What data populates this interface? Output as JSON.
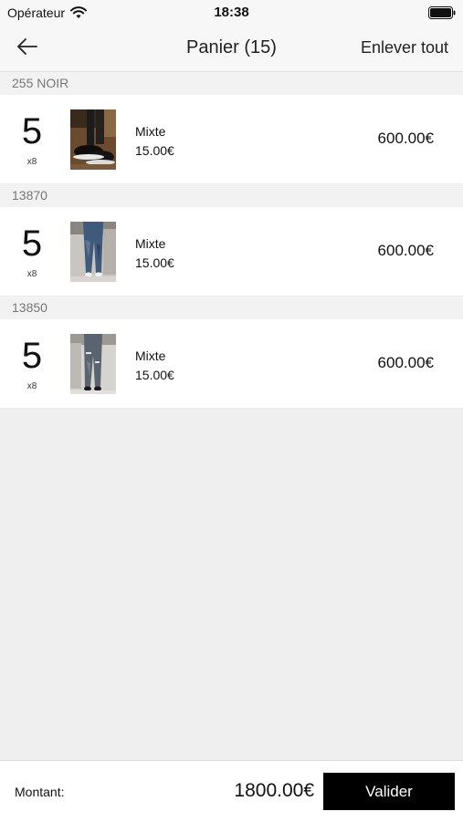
{
  "status_bar": {
    "carrier": "Opérateur",
    "time": "18:38"
  },
  "nav": {
    "title": "Panier (15)",
    "remove_all": "Enlever tout"
  },
  "sections": [
    {
      "header": "255 NOIR",
      "quantity": "5",
      "multiplier": "x8",
      "type": "Mixte",
      "unit_price": "15.00€",
      "total": "600.00€",
      "thumbnail": "shoes-photo"
    },
    {
      "header": "13870",
      "quantity": "5",
      "multiplier": "x8",
      "type": "Mixte",
      "unit_price": "15.00€",
      "total": "600.00€",
      "thumbnail": "jeans-photo"
    },
    {
      "header": "13850",
      "quantity": "5",
      "multiplier": "x8",
      "type": "Mixte",
      "unit_price": "15.00€",
      "total": "600.00€",
      "thumbnail": "jeans-photo"
    }
  ],
  "footer": {
    "amount_label": "Montant:",
    "amount_value": "1800.00€",
    "validate_label": "Valider"
  },
  "colors": {
    "background": "#efefef",
    "button_bg": "#000000",
    "button_text": "#ffffff",
    "section_header_text": "#777777"
  }
}
